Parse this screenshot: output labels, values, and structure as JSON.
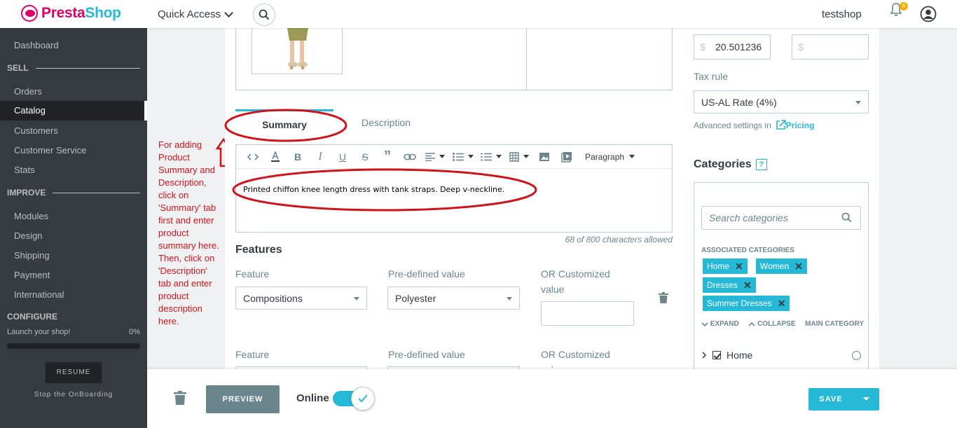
{
  "header": {
    "logo_text_a": "Presta",
    "logo_text_b": "Shop",
    "quick_access": "Quick Access",
    "shop_name": "testshop",
    "notifications_count": "6"
  },
  "sidebar": {
    "dashboard": "Dashboard",
    "sell": "SELL",
    "orders": "Orders",
    "catalog": "Catalog",
    "customers": "Customers",
    "customer_service": "Customer Service",
    "stats": "Stats",
    "improve": "IMPROVE",
    "modules": "Modules",
    "design": "Design",
    "shipping": "Shipping",
    "payment": "Payment",
    "international": "International",
    "configure": "CONFIGURE",
    "launch": "Launch your shop!",
    "launch_pct": "0%",
    "launch_progress": 0,
    "resume": "RESUME",
    "stop": "Stop the OnBoarding"
  },
  "annotation": {
    "note": "For adding Product Summary and Description, click on 'Summary' tab first and enter product summary here. Then, click on 'Description' tab and enter product description here.",
    "color": "#d0121a"
  },
  "editor": {
    "tab_summary": "Summary",
    "tab_description": "Description",
    "paragraph": "Paragraph",
    "content": "Printed chiffon knee length dress with tank straps. Deep v-neckline.",
    "counter": "68 of 800 characters allowed"
  },
  "features": {
    "title": "Features",
    "feature_label": "Feature",
    "predefined_label": "Pre-defined value",
    "custom_label_1": "OR Customized",
    "custom_label_2": "value",
    "feature_value": "Compositions",
    "predefined_value": "Polyester"
  },
  "pricing": {
    "currency": "$",
    "price_value": "20.501236",
    "tax_label": "Tax rule",
    "tax_value": "US-AL Rate (4%)",
    "advanced": "Advanced settings in",
    "pricing_link": "Pricing"
  },
  "categories": {
    "title": "Categories",
    "help": "?",
    "search_placeholder": "Search categories",
    "associated": "ASSOCIATED CATEGORIES",
    "chips": [
      "Home",
      "Women",
      "Dresses",
      "Summer Dresses"
    ],
    "expand": "EXPAND",
    "collapse": "COLLAPSE",
    "main_category": "MAIN CATEGORY",
    "tree_home": "Home"
  },
  "footer": {
    "preview": "PREVIEW",
    "online": "Online",
    "save": "SAVE"
  },
  "colors": {
    "accent": "#25b9d7",
    "brand": "#df0067",
    "sidebar": "#363a41"
  }
}
